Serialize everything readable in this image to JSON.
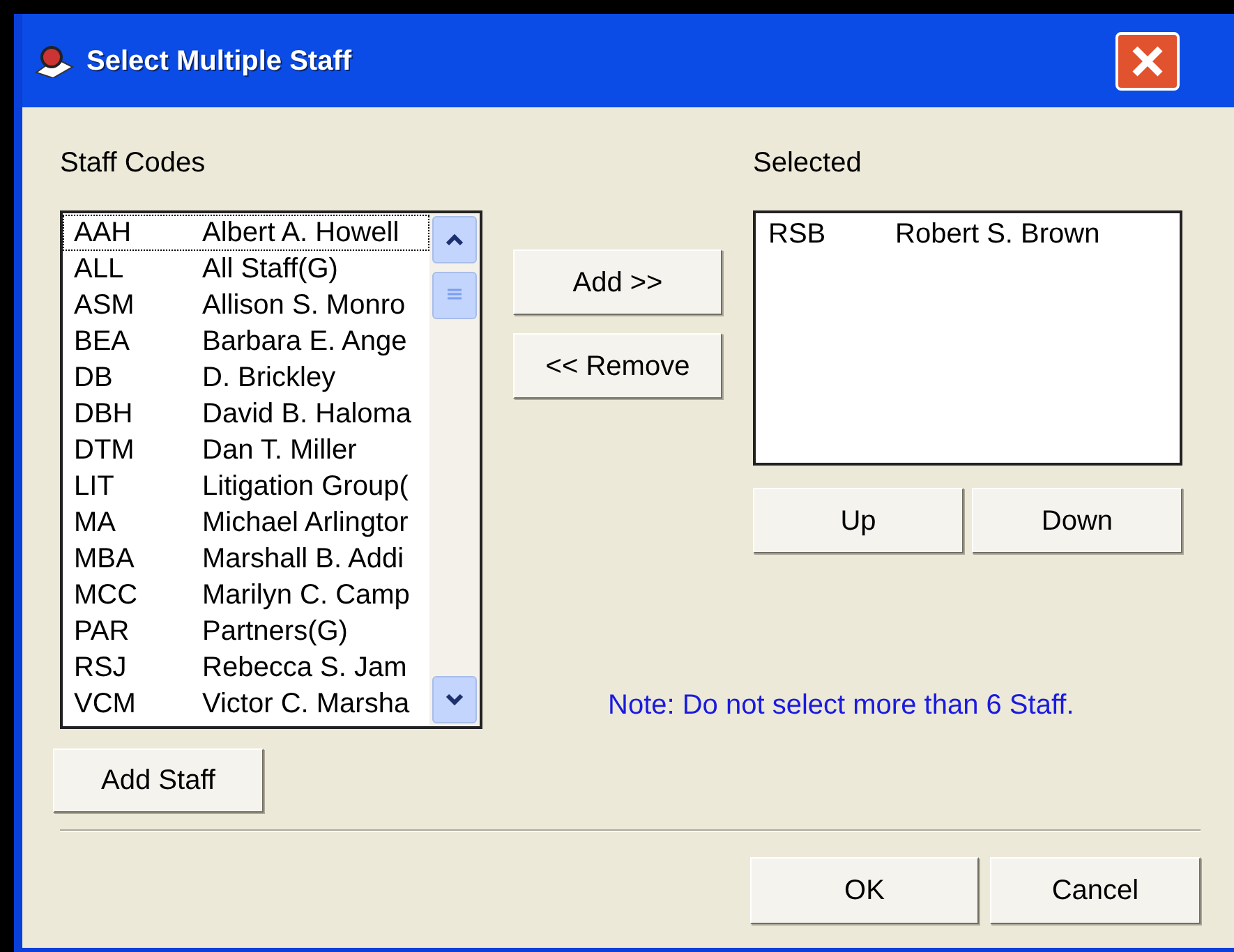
{
  "window": {
    "title": "Select Multiple Staff"
  },
  "staff_codes": {
    "label": "Staff Codes",
    "items": [
      {
        "code": "AAH",
        "name": "Albert A. Howell",
        "focused": true
      },
      {
        "code": "ALL",
        "name": "All Staff(G)",
        "focused": false
      },
      {
        "code": "ASM",
        "name": "Allison S. Monro",
        "focused": false
      },
      {
        "code": "BEA",
        "name": "Barbara E. Ange",
        "focused": false
      },
      {
        "code": "DB",
        "name": "D. Brickley",
        "focused": false
      },
      {
        "code": "DBH",
        "name": "David B. Haloma",
        "focused": false
      },
      {
        "code": "DTM",
        "name": "Dan T. Miller",
        "focused": false
      },
      {
        "code": "LIT",
        "name": "Litigation Group(",
        "focused": false
      },
      {
        "code": "MA",
        "name": "Michael Arlingtor",
        "focused": false
      },
      {
        "code": "MBA",
        "name": "Marshall B. Addi",
        "focused": false
      },
      {
        "code": "MCC",
        "name": "Marilyn C. Camp",
        "focused": false
      },
      {
        "code": "PAR",
        "name": "Partners(G)",
        "focused": false
      },
      {
        "code": "RSJ",
        "name": "Rebecca S. Jam",
        "focused": false
      },
      {
        "code": "VCM",
        "name": "Victor C. Marsha",
        "focused": false
      }
    ]
  },
  "add_staff_button": "Add Staff",
  "move_buttons": [
    "Add >>",
    "<< Remove"
  ],
  "selected": {
    "label": "Selected",
    "items": [
      {
        "code": "RSB",
        "name": "Robert S. Brown"
      }
    ]
  },
  "order_buttons": [
    "Up",
    "Down"
  ],
  "note": "Note: Do not select more than 6 Staff.",
  "dialog_buttons": [
    "OK",
    "Cancel"
  ]
}
